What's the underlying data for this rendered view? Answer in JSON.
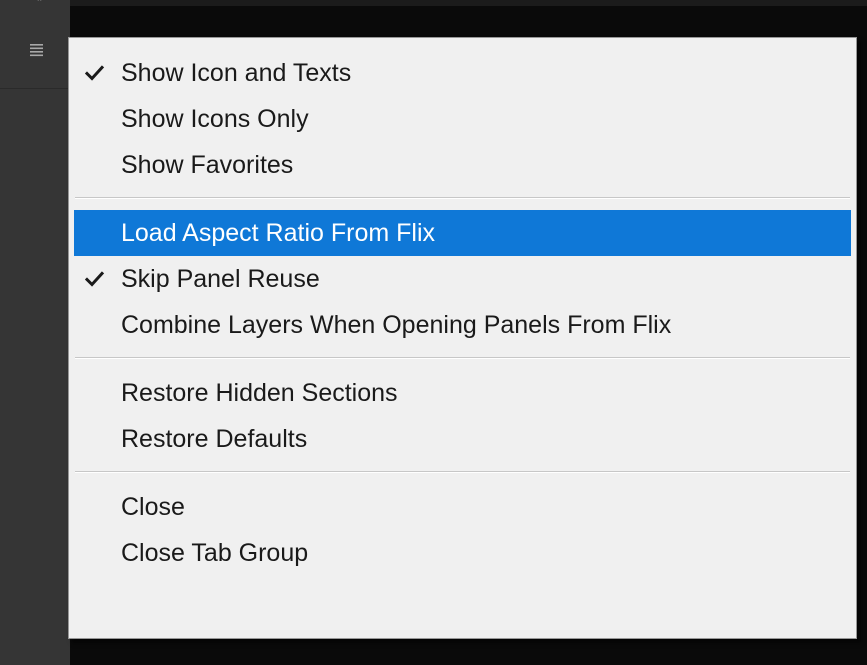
{
  "panel_menu": {
    "icon": "hamburger-menu-icon"
  },
  "menu": {
    "groups": [
      {
        "items": [
          {
            "label": "Show Icon and Texts",
            "checked": true,
            "highlighted": false
          },
          {
            "label": "Show Icons Only",
            "checked": false,
            "highlighted": false
          },
          {
            "label": "Show Favorites",
            "checked": false,
            "highlighted": false
          }
        ]
      },
      {
        "items": [
          {
            "label": "Load Aspect Ratio From Flix",
            "checked": false,
            "highlighted": true
          },
          {
            "label": "Skip Panel Reuse",
            "checked": true,
            "highlighted": false
          },
          {
            "label": "Combine Layers When Opening Panels From Flix",
            "checked": false,
            "highlighted": false
          }
        ]
      },
      {
        "items": [
          {
            "label": "Restore Hidden Sections",
            "checked": false,
            "highlighted": false
          },
          {
            "label": "Restore Defaults",
            "checked": false,
            "highlighted": false
          }
        ]
      },
      {
        "items": [
          {
            "label": "Close",
            "checked": false,
            "highlighted": false
          },
          {
            "label": "Close Tab Group",
            "checked": false,
            "highlighted": false
          }
        ]
      }
    ]
  },
  "colors": {
    "highlight": "#0f78d7",
    "menu_background": "#f0f0f0",
    "panel_background": "#353535"
  }
}
